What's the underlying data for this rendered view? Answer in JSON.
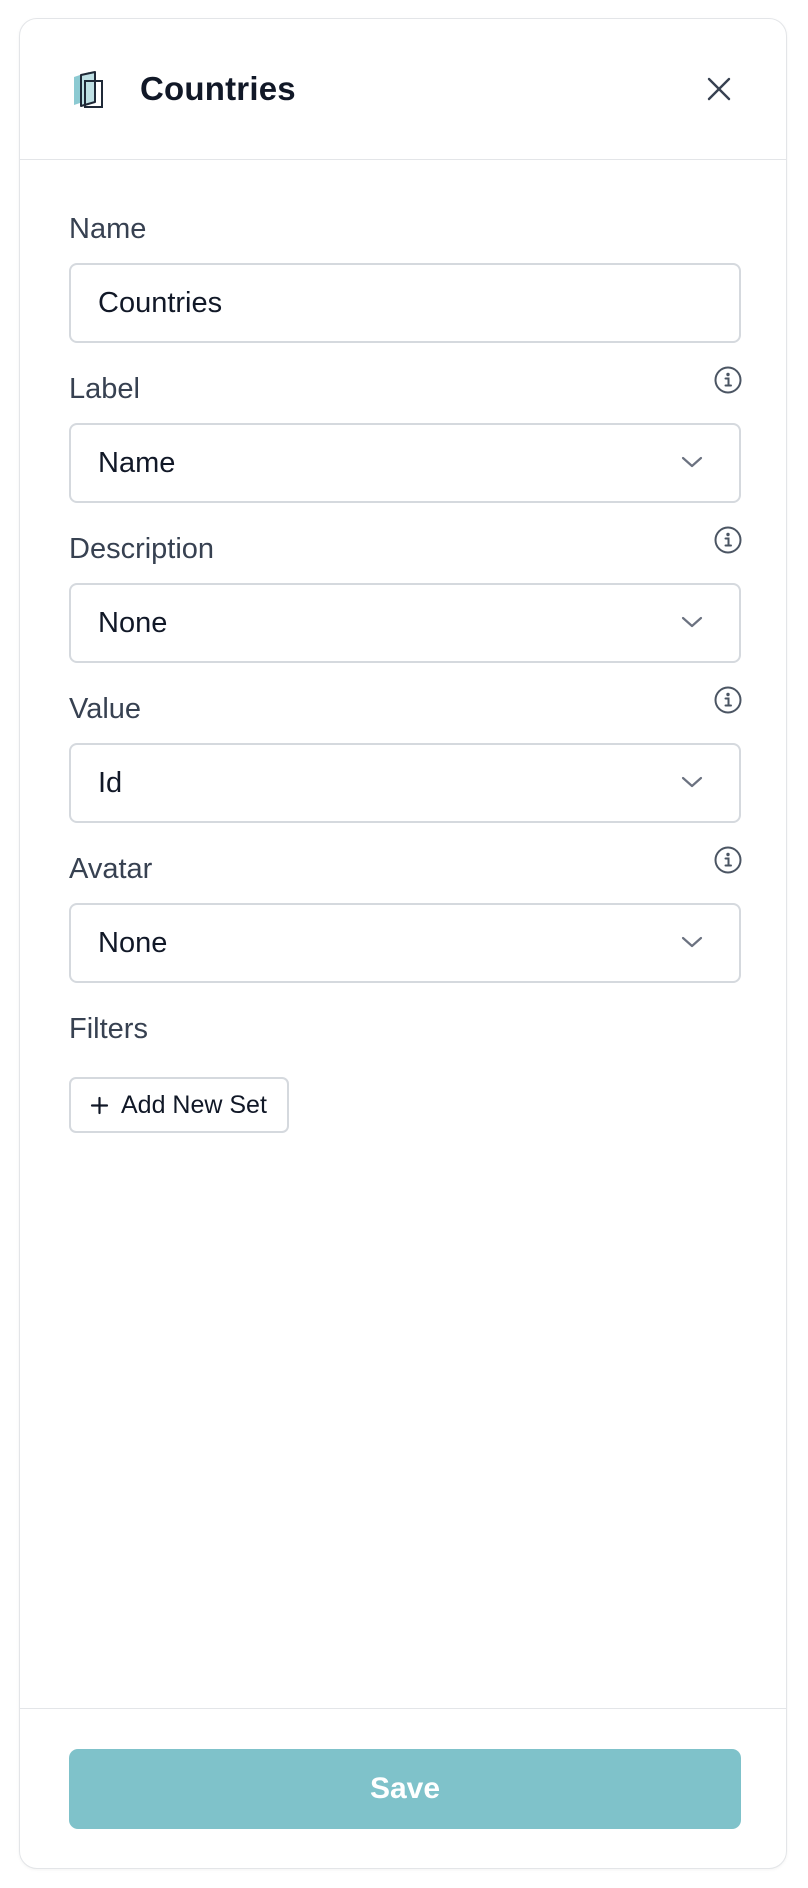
{
  "header": {
    "title": "Countries",
    "icon": "book-icon",
    "close_icon": "close-icon"
  },
  "form": {
    "name": {
      "label": "Name",
      "value": "Countries"
    },
    "label": {
      "label": "Label",
      "value": "Name"
    },
    "description": {
      "label": "Description",
      "value": "None"
    },
    "value": {
      "label": "Value",
      "value": "Id"
    },
    "avatar": {
      "label": "Avatar",
      "value": "None"
    },
    "filters": {
      "label": "Filters",
      "add_button_label": "Add New Set"
    }
  },
  "footer": {
    "save_label": "Save"
  },
  "colors": {
    "accent": "#7fc2ca",
    "icon_teal": "#8ccad2",
    "border": "#d5d9de",
    "text_dark": "#111827",
    "text_label": "#374151"
  }
}
